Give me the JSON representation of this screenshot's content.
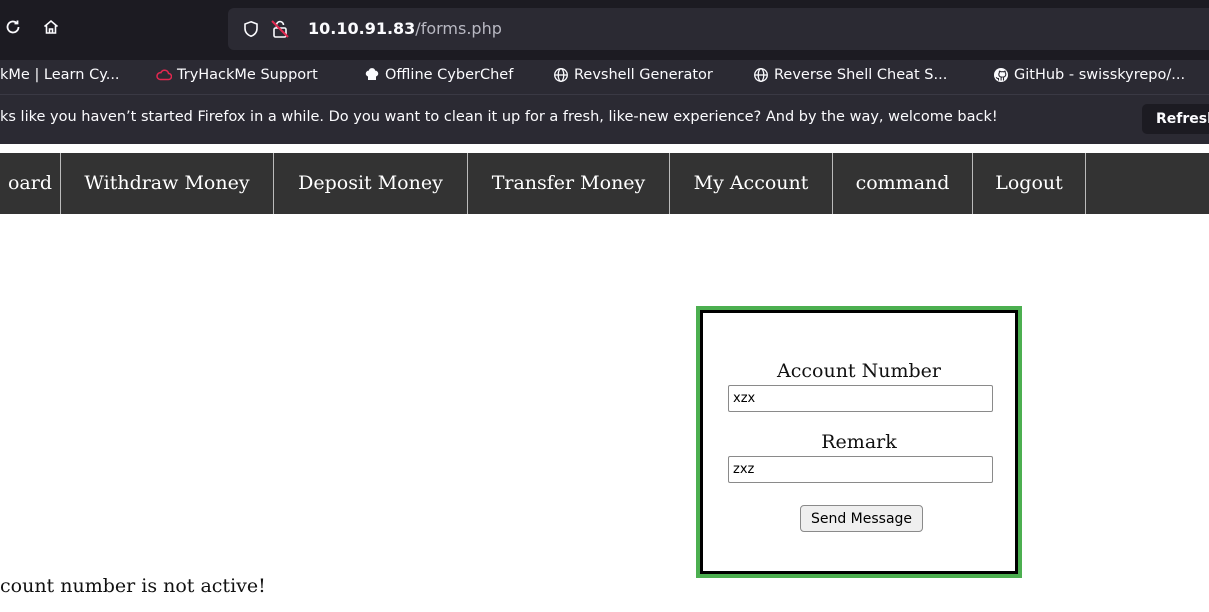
{
  "browser": {
    "url_host": "10.10.91.83",
    "url_path": "/forms.php",
    "bookmarks": [
      {
        "label": "kMe | Learn Cy...",
        "icon": "none"
      },
      {
        "label": "TryHackMe Support",
        "icon": "cloud-icon"
      },
      {
        "label": "Offline CyberChef",
        "icon": "chef-icon"
      },
      {
        "label": "Revshell Generator",
        "icon": "globe-icon"
      },
      {
        "label": "Reverse Shell Cheat S...",
        "icon": "globe-icon"
      },
      {
        "label": "GitHub - swisskyrepo/...",
        "icon": "github-icon"
      }
    ],
    "notice_text": "ks like you haven’t started Firefox in a while. Do you want to clean it up for a fresh, like-new experience? And by the way, welcome back!",
    "refresh_label": "Refresh",
    "colors": {
      "toolbar": "#1c1b22",
      "bar": "#2b2a33",
      "lock": "#e22850"
    }
  },
  "site_nav": {
    "items": [
      "oard",
      "Withdraw Money",
      "Deposit Money",
      "Transfer Money",
      "My Account",
      "command",
      "Logout"
    ],
    "bg_color": "#333333"
  },
  "form": {
    "account_label": "Account Number",
    "account_value": "xzx",
    "remark_label": "Remark",
    "remark_value": "zxz",
    "submit_label": "Send Message",
    "border_color": "#4caf50"
  },
  "status_message": "count number is not active!"
}
